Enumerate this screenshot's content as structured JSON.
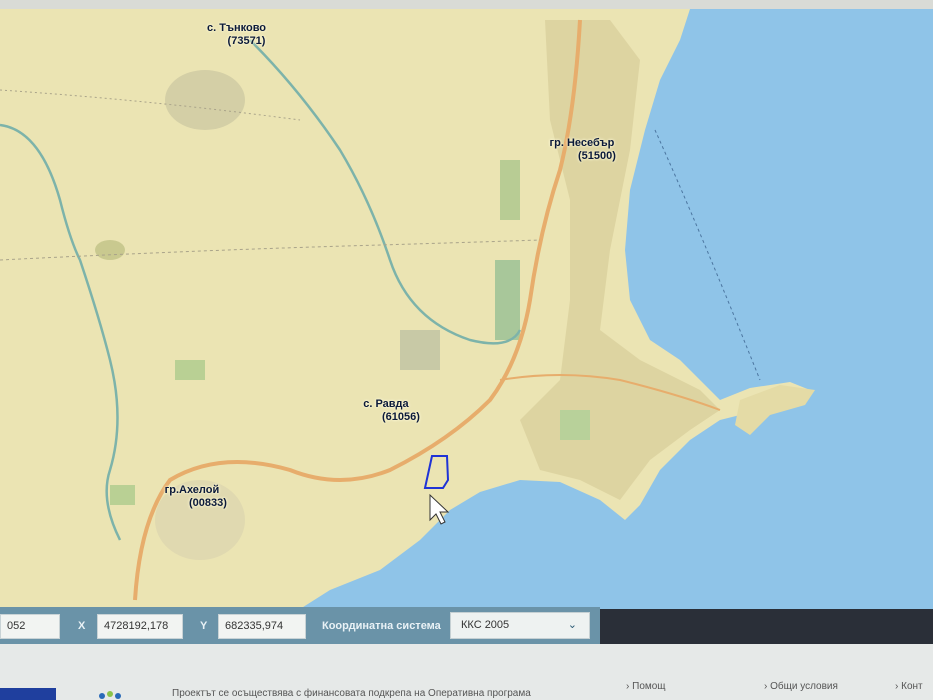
{
  "map": {
    "places": [
      {
        "id": "tankovo",
        "name": "с. Тънково",
        "code": "(73571)"
      },
      {
        "id": "nesebar",
        "name": "гр. Несебър",
        "code": "(51500)"
      },
      {
        "id": "ravda",
        "name": "с. Равда",
        "code": "(61056)"
      },
      {
        "id": "aheloy",
        "name": "гр.Ахелой",
        "code": "(00833)"
      }
    ],
    "colors": {
      "land": "#ece5b4",
      "sea": "#8fc3e6",
      "road": "#e8b070",
      "river": "#7fb0a8",
      "parcel": "#1f33d6"
    }
  },
  "coords": {
    "scale_value": "052",
    "x_label": "X",
    "x_value": "4728192,178",
    "y_label": "Y",
    "y_value": "682335,974",
    "system_label": "Координатна система",
    "system_value": "ККС 2005"
  },
  "footer": {
    "project_text": "Проектът се осъществява с финансовата подкрепа на Оперативна програма",
    "help_link": "Помощ",
    "terms_link": "Общи условия",
    "contacts_link": "Конт"
  }
}
